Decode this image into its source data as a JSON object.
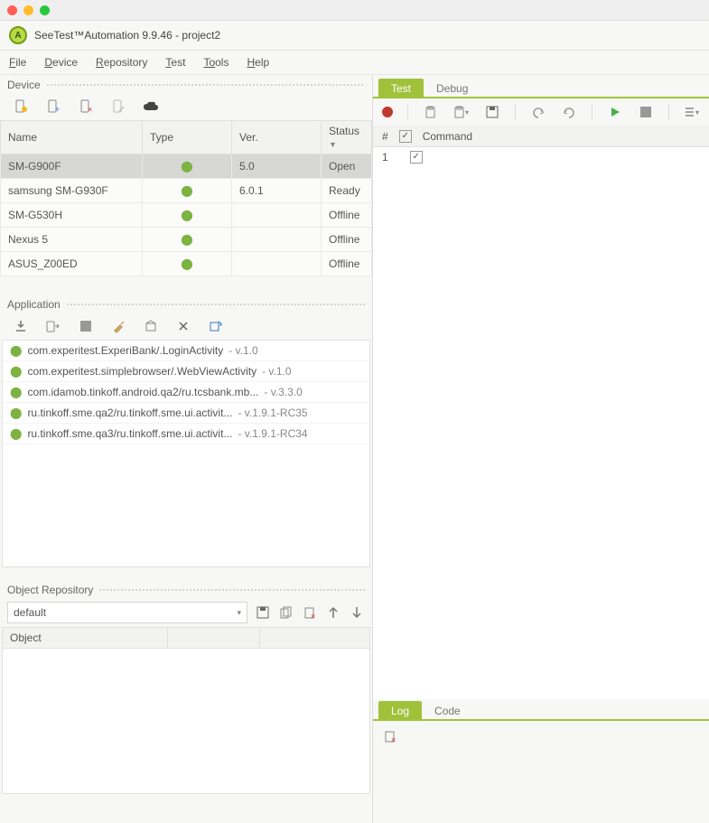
{
  "title": "SeeTest™Automation 9.9.46 - project2",
  "menu": [
    "File",
    "Device",
    "Repository",
    "Test",
    "Tools",
    "Help"
  ],
  "device": {
    "label": "Device",
    "cols": {
      "name": "Name",
      "type": "Type",
      "ver": "Ver.",
      "status": "Status"
    },
    "rows": [
      {
        "name": "SM-G900F",
        "ver": "5.0",
        "status": "Open",
        "sel": true
      },
      {
        "name": "samsung SM-G930F",
        "ver": "6.0.1",
        "status": "Ready",
        "sel": false
      },
      {
        "name": "SM-G530H",
        "ver": "",
        "status": "Offline",
        "sel": false
      },
      {
        "name": "Nexus 5",
        "ver": "",
        "status": "Offline",
        "sel": false
      },
      {
        "name": "ASUS_Z00ED",
        "ver": "",
        "status": "Offline",
        "sel": false
      }
    ]
  },
  "application": {
    "label": "Application",
    "items": [
      {
        "name": "com.experitest.ExperiBank/.LoginActivity",
        "ver": "v.1.0"
      },
      {
        "name": "com.experitest.simplebrowser/.WebViewActivity",
        "ver": "v.1.0"
      },
      {
        "name": "com.idamob.tinkoff.android.qa2/ru.tcsbank.mb...",
        "ver": "v.3.3.0"
      },
      {
        "name": "ru.tinkoff.sme.qa2/ru.tinkoff.sme.ui.activit...",
        "ver": "v.1.9.1-RC35"
      },
      {
        "name": "ru.tinkoff.sme.qa3/ru.tinkoff.sme.ui.activit...",
        "ver": "v.1.9.1-RC34"
      }
    ]
  },
  "object_repo": {
    "label": "Object Repository",
    "selected": "default",
    "col": "Object"
  },
  "right": {
    "tabs": {
      "test": "Test",
      "debug": "Debug"
    },
    "cmd_head": {
      "hash": "#",
      "command": "Command"
    },
    "cmd_rows": [
      {
        "n": "1"
      }
    ],
    "bottom": {
      "log": "Log",
      "code": "Code"
    }
  }
}
